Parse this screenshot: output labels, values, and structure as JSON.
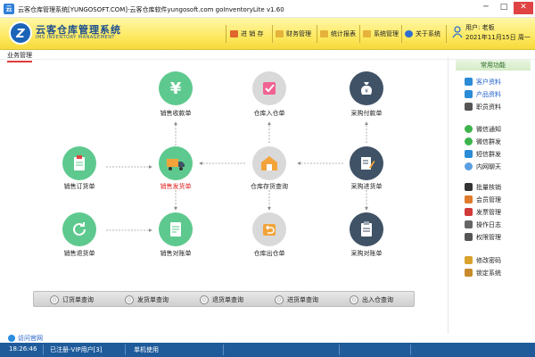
{
  "window": {
    "title": "云客仓库管理系统[YUNGOSOFT.COM]-云客仓库软件yungosoft.com     goInventoryLite v1.60",
    "minimize": "─",
    "maximize": "□",
    "close": "✕"
  },
  "brand": {
    "logo_letter": "Z",
    "name_cn": "云客仓库管理系统",
    "name_en": "IMS INVENTORY MANAGEMENT"
  },
  "nav": [
    {
      "label": "进 销 存",
      "icon": "grid-icon",
      "color": "#e0662c"
    },
    {
      "label": "财务管理",
      "icon": "folder-icon",
      "color": "#e5b23a"
    },
    {
      "label": "统计报表",
      "icon": "folder-icon",
      "color": "#e5b23a"
    },
    {
      "label": "系统管理",
      "icon": "folder-icon",
      "color": "#e5b23a"
    },
    {
      "label": "关于系统",
      "icon": "help-icon",
      "color": "#2f6fd0"
    }
  ],
  "user": {
    "name": "用户: 老板",
    "date": "2021年11月15日 周一"
  },
  "tab": {
    "label": "业务管理"
  },
  "flow_nodes": {
    "sales_receipt": {
      "label": "销售收款单",
      "icon": "yen-icon"
    },
    "stock_in": {
      "label": "仓库入仓单",
      "icon": "checklist-icon"
    },
    "purchase_payment": {
      "label": "采购付款单",
      "icon": "money-bag-icon"
    },
    "sales_order": {
      "label": "销售订货单",
      "icon": "clipboard-icon"
    },
    "sales_delivery": {
      "label": "销售发货单",
      "icon": "truck-icon"
    },
    "inventory_query": {
      "label": "仓库存货查询",
      "icon": "warehouse-icon"
    },
    "purchase_receipt": {
      "label": "采购进货单",
      "icon": "edit-document-icon"
    },
    "sales_return": {
      "label": "销售退货单",
      "icon": "refresh-icon"
    },
    "sales_reconcile": {
      "label": "销售对账单",
      "icon": "document-icon"
    },
    "stock_out": {
      "label": "仓库出仓单",
      "icon": "return-box-icon"
    },
    "purchase_reconcile": {
      "label": "采购对账单",
      "icon": "clipboard-icon"
    }
  },
  "query_bar": [
    {
      "label": "订货单查询"
    },
    {
      "label": "发货单查询"
    },
    {
      "label": "退货单查询"
    },
    {
      "label": "进货单查询"
    },
    {
      "label": "出入仓查询"
    }
  ],
  "sidebar": {
    "header": "常用功能",
    "items": [
      {
        "label": "客户资料",
        "icon": "customers-icon",
        "color": "#2a8bd6"
      },
      {
        "label": "产品资料",
        "icon": "products-icon",
        "color": "#2a8bd6"
      },
      {
        "label": "职员资料",
        "icon": "staff-icon",
        "color": "#555555"
      },
      {
        "label": "微信通知",
        "icon": "wechat-icon",
        "color": "#3cb44b"
      },
      {
        "label": "微信群发",
        "icon": "wechat-icon",
        "color": "#3cb44b"
      },
      {
        "label": "短信群发",
        "icon": "sms-icon",
        "color": "#2a8bd6"
      },
      {
        "label": "内网聊天",
        "icon": "chat-icon",
        "color": "#5aa0e0"
      },
      {
        "label": "批量核销",
        "icon": "batch-icon",
        "color": "#333333"
      },
      {
        "label": "会员管理",
        "icon": "member-icon",
        "color": "#e07a2c"
      },
      {
        "label": "发票管理",
        "icon": "invoice-icon",
        "color": "#d23a3a"
      },
      {
        "label": "操作日志",
        "icon": "log-icon",
        "color": "#666666"
      },
      {
        "label": "权限管理",
        "icon": "permission-icon",
        "color": "#555555"
      },
      {
        "label": "修改密码",
        "icon": "key-icon",
        "color": "#d9a22c"
      },
      {
        "label": "锁定系统",
        "icon": "lock-icon",
        "color": "#c98a2c"
      }
    ]
  },
  "footer": {
    "visit_link": "访问官网"
  },
  "status_bar": {
    "time": "18:26:46",
    "registration": "已注册-VIP用户[3]",
    "mode": "单机使用"
  },
  "colors": {
    "banner": "#fde961",
    "status_bar": "#1f5b9b",
    "node_green": "#5ec98e",
    "node_dark": "#3f5266",
    "highlight_label": "#e02020"
  }
}
